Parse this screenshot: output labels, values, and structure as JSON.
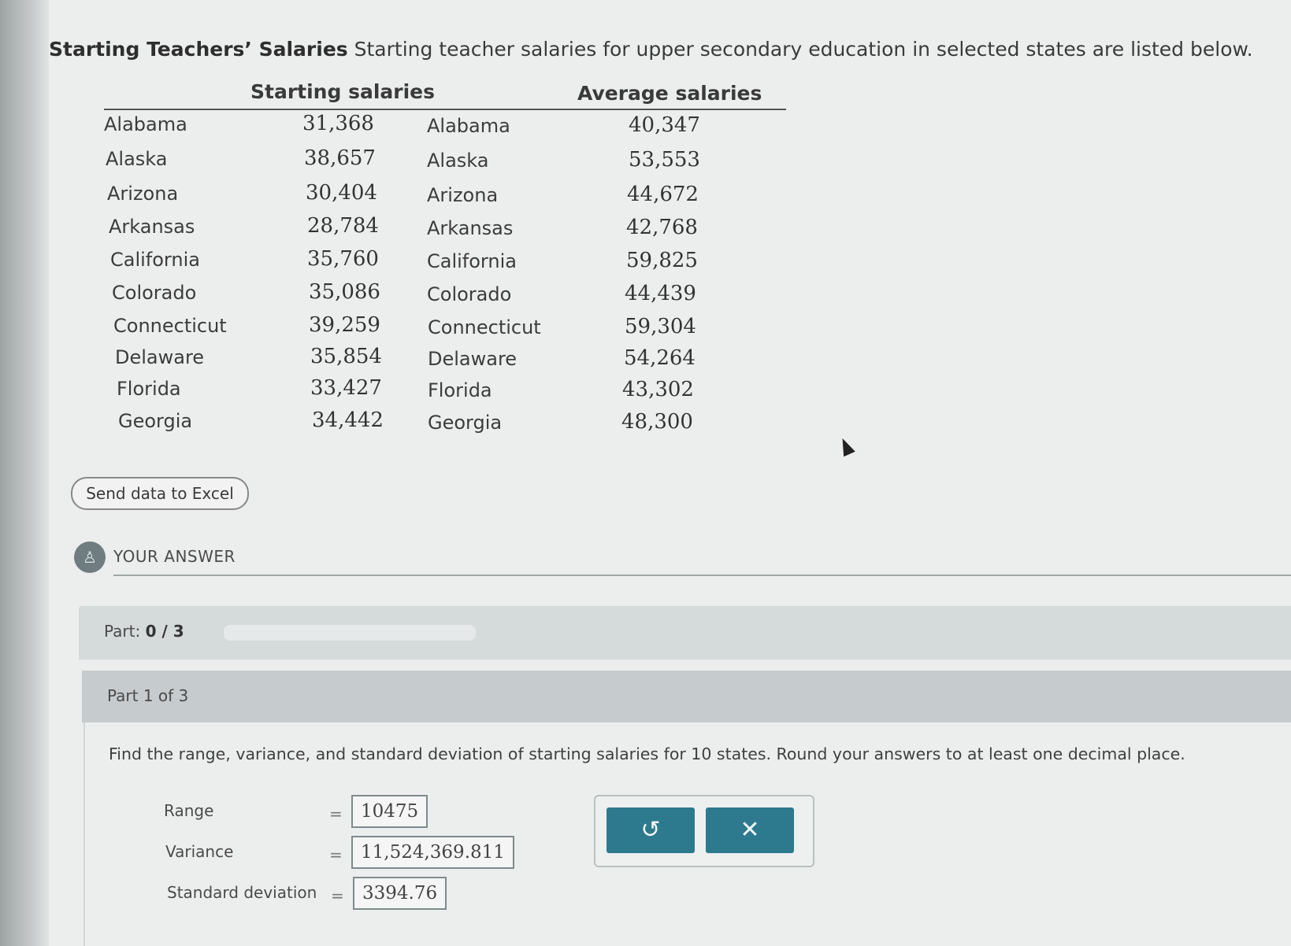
{
  "intro": {
    "title": "Starting Teachers’ Salaries",
    "text": "Starting teacher salaries for upper secondary education in selected states are listed below."
  },
  "table": {
    "header_left": "Starting salaries",
    "header_right": "Average salaries",
    "rows": [
      {
        "state_left": "Alabama",
        "starting": "31,368",
        "state_right": "Alabama",
        "average": "40,347"
      },
      {
        "state_left": "Alaska",
        "starting": "38,657",
        "state_right": "Alaska",
        "average": "53,553"
      },
      {
        "state_left": "Arizona",
        "starting": "30,404",
        "state_right": "Arizona",
        "average": "44,672"
      },
      {
        "state_left": "Arkansas",
        "starting": "28,784",
        "state_right": "Arkansas",
        "average": "42,768"
      },
      {
        "state_left": "California",
        "starting": "35,760",
        "state_right": "California",
        "average": "59,825"
      },
      {
        "state_left": "Colorado",
        "starting": "35,086",
        "state_right": "Colorado",
        "average": "44,439"
      },
      {
        "state_left": "Connecticut",
        "starting": "39,259",
        "state_right": "Connecticut",
        "average": "59,304"
      },
      {
        "state_left": "Delaware",
        "starting": "35,854",
        "state_right": "Delaware",
        "average": "54,264"
      },
      {
        "state_left": "Florida",
        "starting": "33,427",
        "state_right": "Florida",
        "average": "43,302"
      },
      {
        "state_left": "Georgia",
        "starting": "34,442",
        "state_right": "Georgia",
        "average": "48,300"
      }
    ]
  },
  "excel_button": "Send data to Excel",
  "your_answer": {
    "icon": "person-icon",
    "label": "YOUR ANSWER"
  },
  "part_progress": {
    "label": "Part:",
    "value": "0 / 3",
    "fraction": 0
  },
  "part_of": "Part 1 of 3",
  "question": "Find the range, variance, and standard deviation of starting salaries for 10 states. Round your answers to at least one decimal place.",
  "fields": {
    "range": {
      "label": "Range",
      "eq": "=",
      "value": "10475"
    },
    "variance": {
      "label": "Variance",
      "eq": "=",
      "value": "11,524,369.811"
    },
    "std": {
      "label": "Standard deviation",
      "eq": "=",
      "value": "3394.76"
    }
  },
  "buttons": {
    "undo": {
      "icon": "undo-icon",
      "glyph": "↺"
    },
    "clear": {
      "icon": "close-icon",
      "glyph": "✕"
    }
  },
  "colors": {
    "accent": "#2d7a8f",
    "panel": "#d5dadb"
  }
}
